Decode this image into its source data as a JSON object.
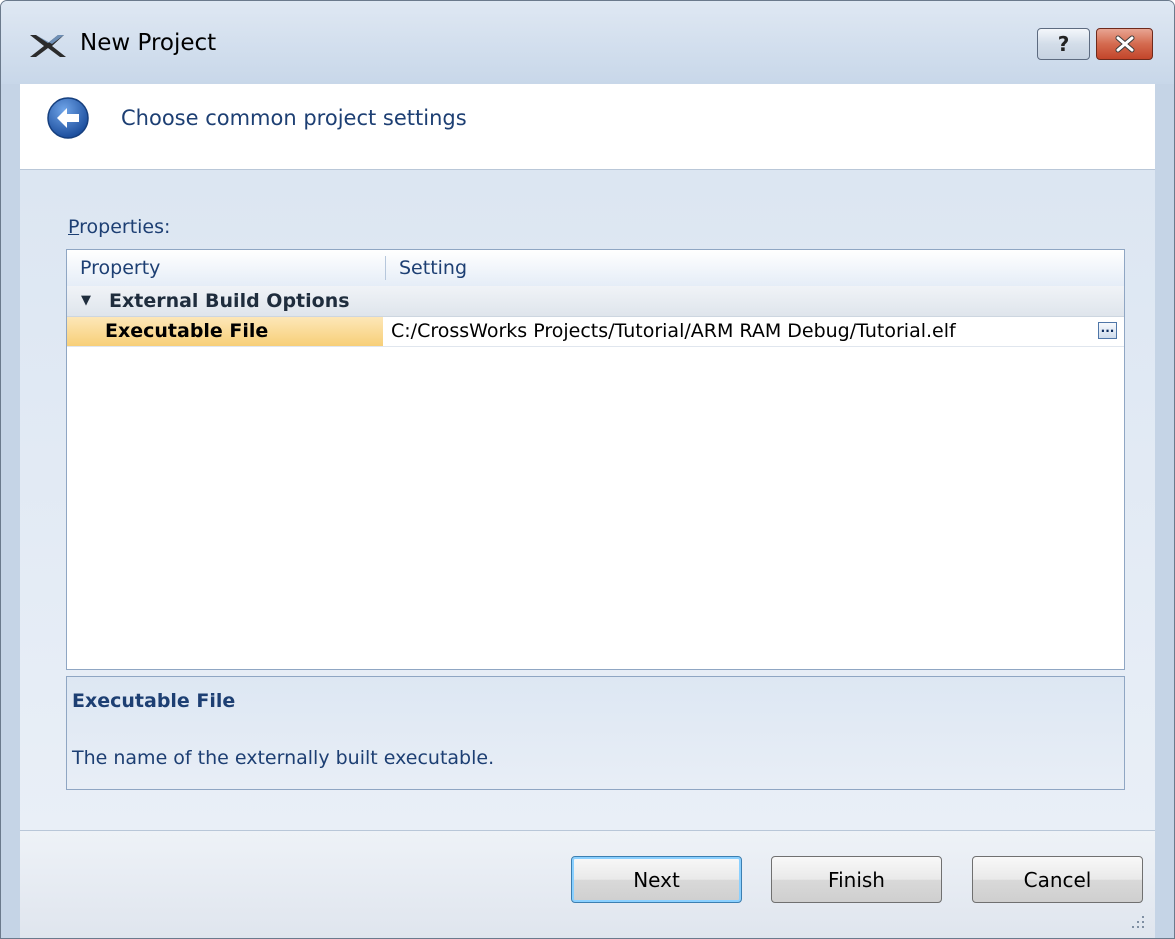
{
  "window": {
    "title": "New Project",
    "help_glyph": "?",
    "help_icon": "help-question-icon",
    "close_icon": "close-x-icon"
  },
  "header": {
    "back_icon": "back-arrow-icon",
    "step_title": "Choose common project settings"
  },
  "properties": {
    "label_mnemonic": "P",
    "label_rest": "roperties:",
    "columns": [
      "Property",
      "Setting"
    ],
    "group": {
      "label": "External Build Options",
      "toggle_glyph": "▼",
      "expanded": true
    },
    "rows": [
      {
        "name": "Executable File",
        "value": "C:/CrossWorks Projects/Tutorial/ARM RAM Debug/Tutorial.elf",
        "browse_glyph": "···",
        "selected": true
      }
    ]
  },
  "description": {
    "title": "Executable File",
    "text": "The name of the externally built executable."
  },
  "buttons": {
    "next": "Next",
    "finish": "Finish",
    "cancel": "Cancel"
  },
  "colors": {
    "accent_text": "#1d3f73",
    "selection": "#f7cf78",
    "frame": "#c5d4e6"
  }
}
